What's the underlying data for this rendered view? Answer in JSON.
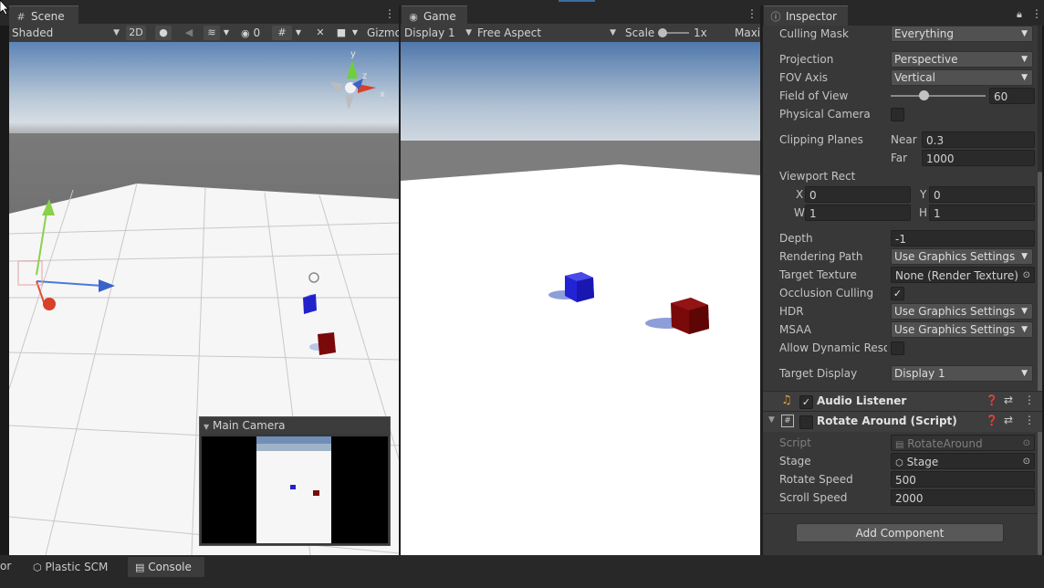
{
  "scene": {
    "tab_label": "Scene",
    "shading_mode": "Shaded",
    "btn_2d": "2D",
    "hidden_count": "0",
    "gizmos_label": "Gizmo",
    "axis_x": "x",
    "axis_y": "y",
    "axis_z": "z",
    "camera_preview_title": "Main Camera"
  },
  "game": {
    "tab_label": "Game",
    "display": "Display 1",
    "aspect": "Free Aspect",
    "scale_label": "Scale",
    "scale_value": "1x",
    "maximize_label": "Maxi"
  },
  "inspector": {
    "tab_label": "Inspector",
    "culling_mask": {
      "label": "Culling Mask",
      "value": "Everything"
    },
    "projection": {
      "label": "Projection",
      "value": "Perspective"
    },
    "fov_axis": {
      "label": "FOV Axis",
      "value": "Vertical"
    },
    "field_of_view": {
      "label": "Field of View",
      "value": "60",
      "slider_fraction": 0.35
    },
    "physical_camera": {
      "label": "Physical Camera"
    },
    "clipping": {
      "label": "Clipping Planes",
      "near_label": "Near",
      "near": "0.3",
      "far_label": "Far",
      "far": "1000"
    },
    "viewport": {
      "label": "Viewport Rect",
      "x_label": "X",
      "x": "0",
      "y_label": "Y",
      "y": "0",
      "w_label": "W",
      "w": "1",
      "h_label": "H",
      "h": "1"
    },
    "depth": {
      "label": "Depth",
      "value": "-1"
    },
    "rendering_path": {
      "label": "Rendering Path",
      "value": "Use Graphics Settings"
    },
    "target_texture": {
      "label": "Target Texture",
      "value": "None (Render Texture)"
    },
    "occlusion_culling": {
      "label": "Occlusion Culling"
    },
    "hdr": {
      "label": "HDR",
      "value": "Use Graphics Settings"
    },
    "msaa": {
      "label": "MSAA",
      "value": "Use Graphics Settings"
    },
    "allow_dynamic": {
      "label": "Allow Dynamic Resol"
    },
    "target_display": {
      "label": "Target Display",
      "value": "Display 1"
    },
    "audio_listener": {
      "title": "Audio Listener"
    },
    "rotate_around": {
      "title": "Rotate Around (Script)",
      "script_label": "Script",
      "script_value": "RotateAround",
      "stage_label": "Stage",
      "stage_value": "Stage",
      "rotate_speed_label": "Rotate Speed",
      "rotate_speed": "500",
      "scroll_speed_label": "Scroll Speed",
      "scroll_speed": "2000"
    },
    "add_component": "Add Component"
  },
  "bottom_tabs": {
    "partial": "or",
    "plastic": "Plastic SCM",
    "console": "Console"
  },
  "colors": {
    "accent_blue": "#2c5d87",
    "cube_blue": "#2222cc",
    "cube_red": "#7a0a0a",
    "sky": "#d8dee6",
    "ground": "#6e6e6e"
  }
}
